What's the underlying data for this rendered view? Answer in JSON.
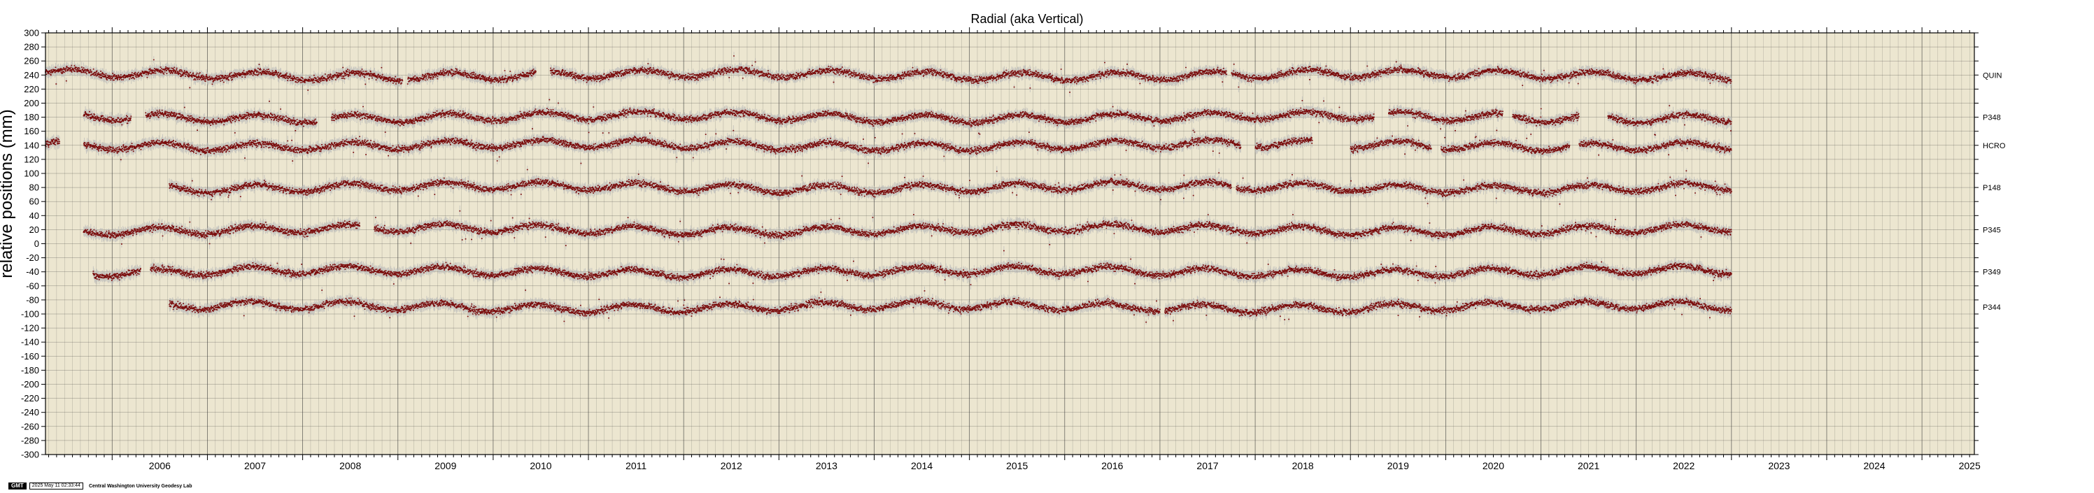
{
  "chart_data": {
    "type": "scatter",
    "title": "Radial (aka Vertical)",
    "ylabel": "relative positions (mm)",
    "xlabel": "",
    "xlim": [
      2005.3,
      2025.55
    ],
    "ylim": [
      -300,
      300
    ],
    "y_ticks": [
      300,
      280,
      260,
      240,
      220,
      200,
      180,
      160,
      140,
      120,
      100,
      80,
      60,
      40,
      20,
      0,
      -20,
      -40,
      -60,
      -80,
      -100,
      -120,
      -140,
      -160,
      -180,
      -200,
      -220,
      -240,
      -260,
      -280,
      -300
    ],
    "x_ticks": [
      "2006",
      "2007",
      "2008",
      "2009",
      "2010",
      "2011",
      "2012",
      "2013",
      "2014",
      "2015",
      "2016",
      "2017",
      "2018",
      "2019",
      "2020",
      "2021",
      "2022",
      "2023",
      "2024",
      "2025"
    ],
    "grid": true,
    "background": "#ece6d0",
    "point_color": "#7a0b0b",
    "error_color": "#b9b9b9",
    "series": [
      {
        "name": "QUIN",
        "offset": 240,
        "start": 2005.3,
        "end": 2023.0,
        "gaps": [
          [
            2009.05,
            2009.1
          ],
          [
            2010.45,
            2010.6
          ],
          [
            2017.7,
            2017.75
          ]
        ]
      },
      {
        "name": "P348",
        "offset": 180,
        "start": 2005.7,
        "end": 2023.0,
        "gaps": [
          [
            2006.2,
            2006.35
          ],
          [
            2008.15,
            2008.3
          ],
          [
            2019.25,
            2019.4
          ],
          [
            2020.6,
            2020.7
          ],
          [
            2021.4,
            2021.7
          ]
        ]
      },
      {
        "name": "HCRO",
        "offset": 140,
        "start": 2005.3,
        "end": 2023.0,
        "gaps": [
          [
            2005.45,
            2005.7
          ],
          [
            2017.85,
            2018.0
          ],
          [
            2018.6,
            2019.0
          ],
          [
            2019.85,
            2019.95
          ],
          [
            2021.3,
            2021.4
          ]
        ]
      },
      {
        "name": "P148",
        "offset": 80,
        "start": 2006.6,
        "end": 2023.0,
        "gaps": [
          [
            2017.75,
            2017.8
          ]
        ]
      },
      {
        "name": "P345",
        "offset": 20,
        "start": 2005.7,
        "end": 2023.0,
        "gaps": [
          [
            2008.6,
            2008.75
          ]
        ]
      },
      {
        "name": "P349",
        "offset": -40,
        "start": 2005.8,
        "end": 2023.0,
        "gaps": [
          [
            2006.3,
            2006.4
          ]
        ]
      },
      {
        "name": "P344",
        "offset": -90,
        "start": 2006.6,
        "end": 2023.0,
        "gaps": [
          [
            2017.0,
            2017.05
          ]
        ]
      }
    ]
  },
  "footer": {
    "logo": "GMT",
    "timestamp": "2025 May 11 02:33:44",
    "lab": "Central Washington University Geodesy Lab"
  }
}
